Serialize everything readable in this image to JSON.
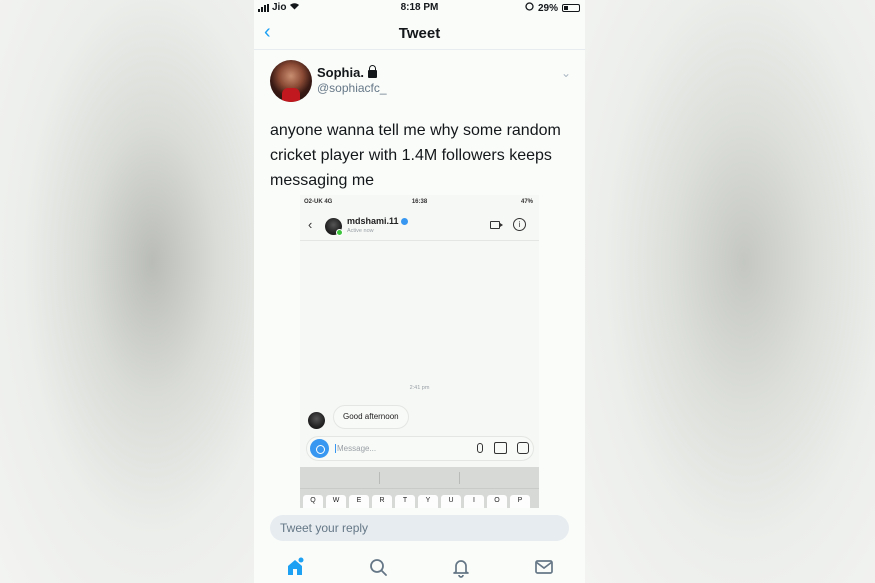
{
  "status_bar": {
    "carrier": "Jio",
    "time": "8:18 PM",
    "battery": "29%"
  },
  "nav": {
    "title": "Tweet"
  },
  "tweet": {
    "display_name": "Sophia.",
    "handle": "@sophiacfc_",
    "text": "anyone wanna tell me why some random cricket player with 1.4M followers keeps messaging me"
  },
  "embedded_screenshot": {
    "status": {
      "carrier": "O2-UK 4G",
      "time": "16:38",
      "battery": "47%"
    },
    "contact_name": "mdshami.11",
    "contact_status": "Active now",
    "message_time": "2:41 pm",
    "message_text": "Good afternoon",
    "input_placeholder": "Message...",
    "keyboard_keys": [
      "Q",
      "W",
      "E",
      "R",
      "T",
      "Y",
      "U",
      "I",
      "O",
      "P"
    ]
  },
  "reply": {
    "placeholder": "Tweet your reply"
  },
  "tab_bar": {
    "items": [
      "home-icon",
      "search-icon",
      "notifications-icon",
      "messages-icon"
    ],
    "accent": "#1da1f2"
  }
}
